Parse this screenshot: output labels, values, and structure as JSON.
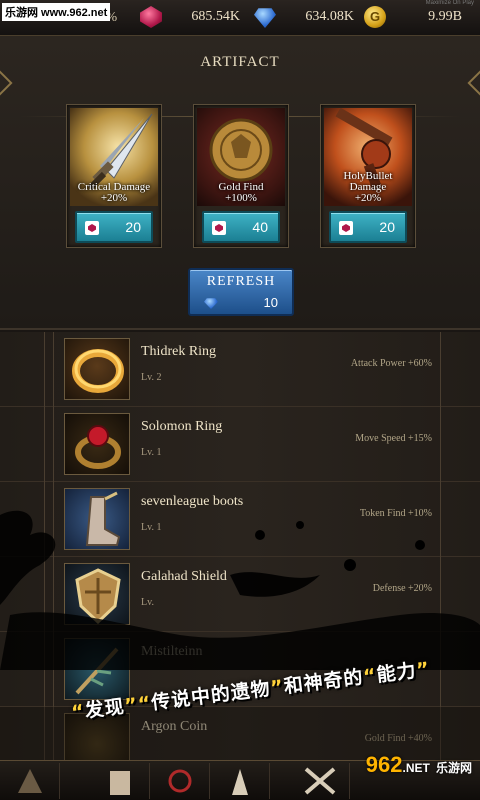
{
  "watermark": "乐游网 www.962.net",
  "topbar": {
    "level_pct": "0.0%",
    "ruby": "685.54K",
    "sapphire": "634.08K",
    "gold": "9.99B",
    "gold_icon": "G",
    "top_small": "Maximize On Play"
  },
  "panel": {
    "title": "ARTIFACT",
    "cards": [
      {
        "label_1": "Critical Damage",
        "label_2": "+20%",
        "cost": "20"
      },
      {
        "label_1": "Gold Find",
        "label_2": "+100%",
        "cost": "40"
      },
      {
        "label_1": "HolyBullet",
        "label_2": "Damage",
        "label_3": "+20%",
        "cost": "20"
      }
    ],
    "refresh": {
      "label": "REFRESH",
      "cost": "10"
    }
  },
  "items": [
    {
      "name": "Thidrek Ring",
      "lv": "Lv. 2",
      "stat": "Attack Power +60%"
    },
    {
      "name": "Solomon Ring",
      "lv": "Lv. 1",
      "stat": "Move Speed +15%"
    },
    {
      "name": "sevenleague boots",
      "lv": "Lv. 1",
      "stat": "Token Find +10%"
    },
    {
      "name": "Galahad Shield",
      "lv": "Lv.",
      "stat": "Defense +20%"
    },
    {
      "name": "Mistilteinn",
      "lv": "",
      "stat": ""
    },
    {
      "name": "Argon Coin",
      "lv": "",
      "stat": "Gold Find +40%"
    }
  ],
  "promo": {
    "q1": "“",
    "w1": "发现",
    "q2": "”",
    "q3": "“",
    "w2": "传说中的遗物",
    "q4": "”",
    "w3": "和神奇的",
    "q5": "“",
    "w4": "能力",
    "q6": "”"
  },
  "logo": {
    "num": "962",
    "dot": ".NET",
    "cn": "乐游网"
  },
  "colors": {
    "ruby": "#b0174a",
    "sapphire": "#2c6ad0",
    "gold": "#d4a017",
    "cyan_button": "#1b7f93",
    "blue_button": "#1d4f8a"
  }
}
